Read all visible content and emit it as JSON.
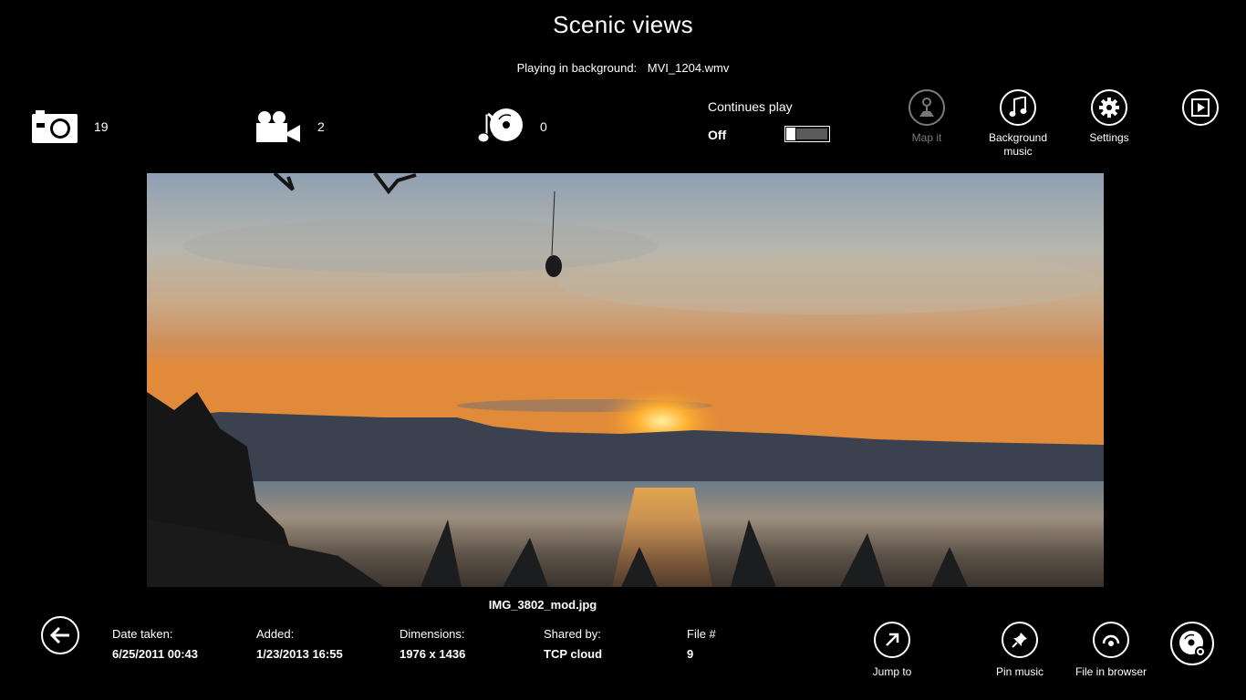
{
  "header": {
    "title": "Scenic views",
    "playing_label": "Playing in background:",
    "playing_file": "MVI_1204.wmv"
  },
  "stats": {
    "photos": "19",
    "videos": "2",
    "music": "0"
  },
  "continues_play": {
    "label": "Continues play",
    "state": "Off"
  },
  "app_buttons": {
    "map": "Map it",
    "music": "Background music",
    "settings": "Settings"
  },
  "photo": {
    "filename": "IMG_3802_mod.jpg"
  },
  "details": {
    "date_taken_label": "Date taken:",
    "date_taken": "6/25/2011 00:43",
    "added_label": "Added:",
    "added": "1/23/2013 16:55",
    "dimensions_label": "Dimensions:",
    "dimensions": "1976 x 1436",
    "shared_label": "Shared by:",
    "shared": "TCP cloud",
    "file_label": "File #",
    "file_num": "9"
  },
  "bottom_buttons": {
    "jump": "Jump to",
    "pin": "Pin music",
    "browser": "File in browser"
  },
  "icons": {
    "camera": "camera-icon",
    "video": "video-camera-icon",
    "music": "music-disc-icon",
    "map": "map-pin-icon",
    "note": "music-note-icon",
    "gear": "gear-icon",
    "slideshow": "play-slideshow-icon",
    "back": "back-arrow-icon",
    "jump": "jump-arrow-icon",
    "pin": "pin-icon",
    "browser": "browser-icon",
    "disc": "disc-icon"
  }
}
